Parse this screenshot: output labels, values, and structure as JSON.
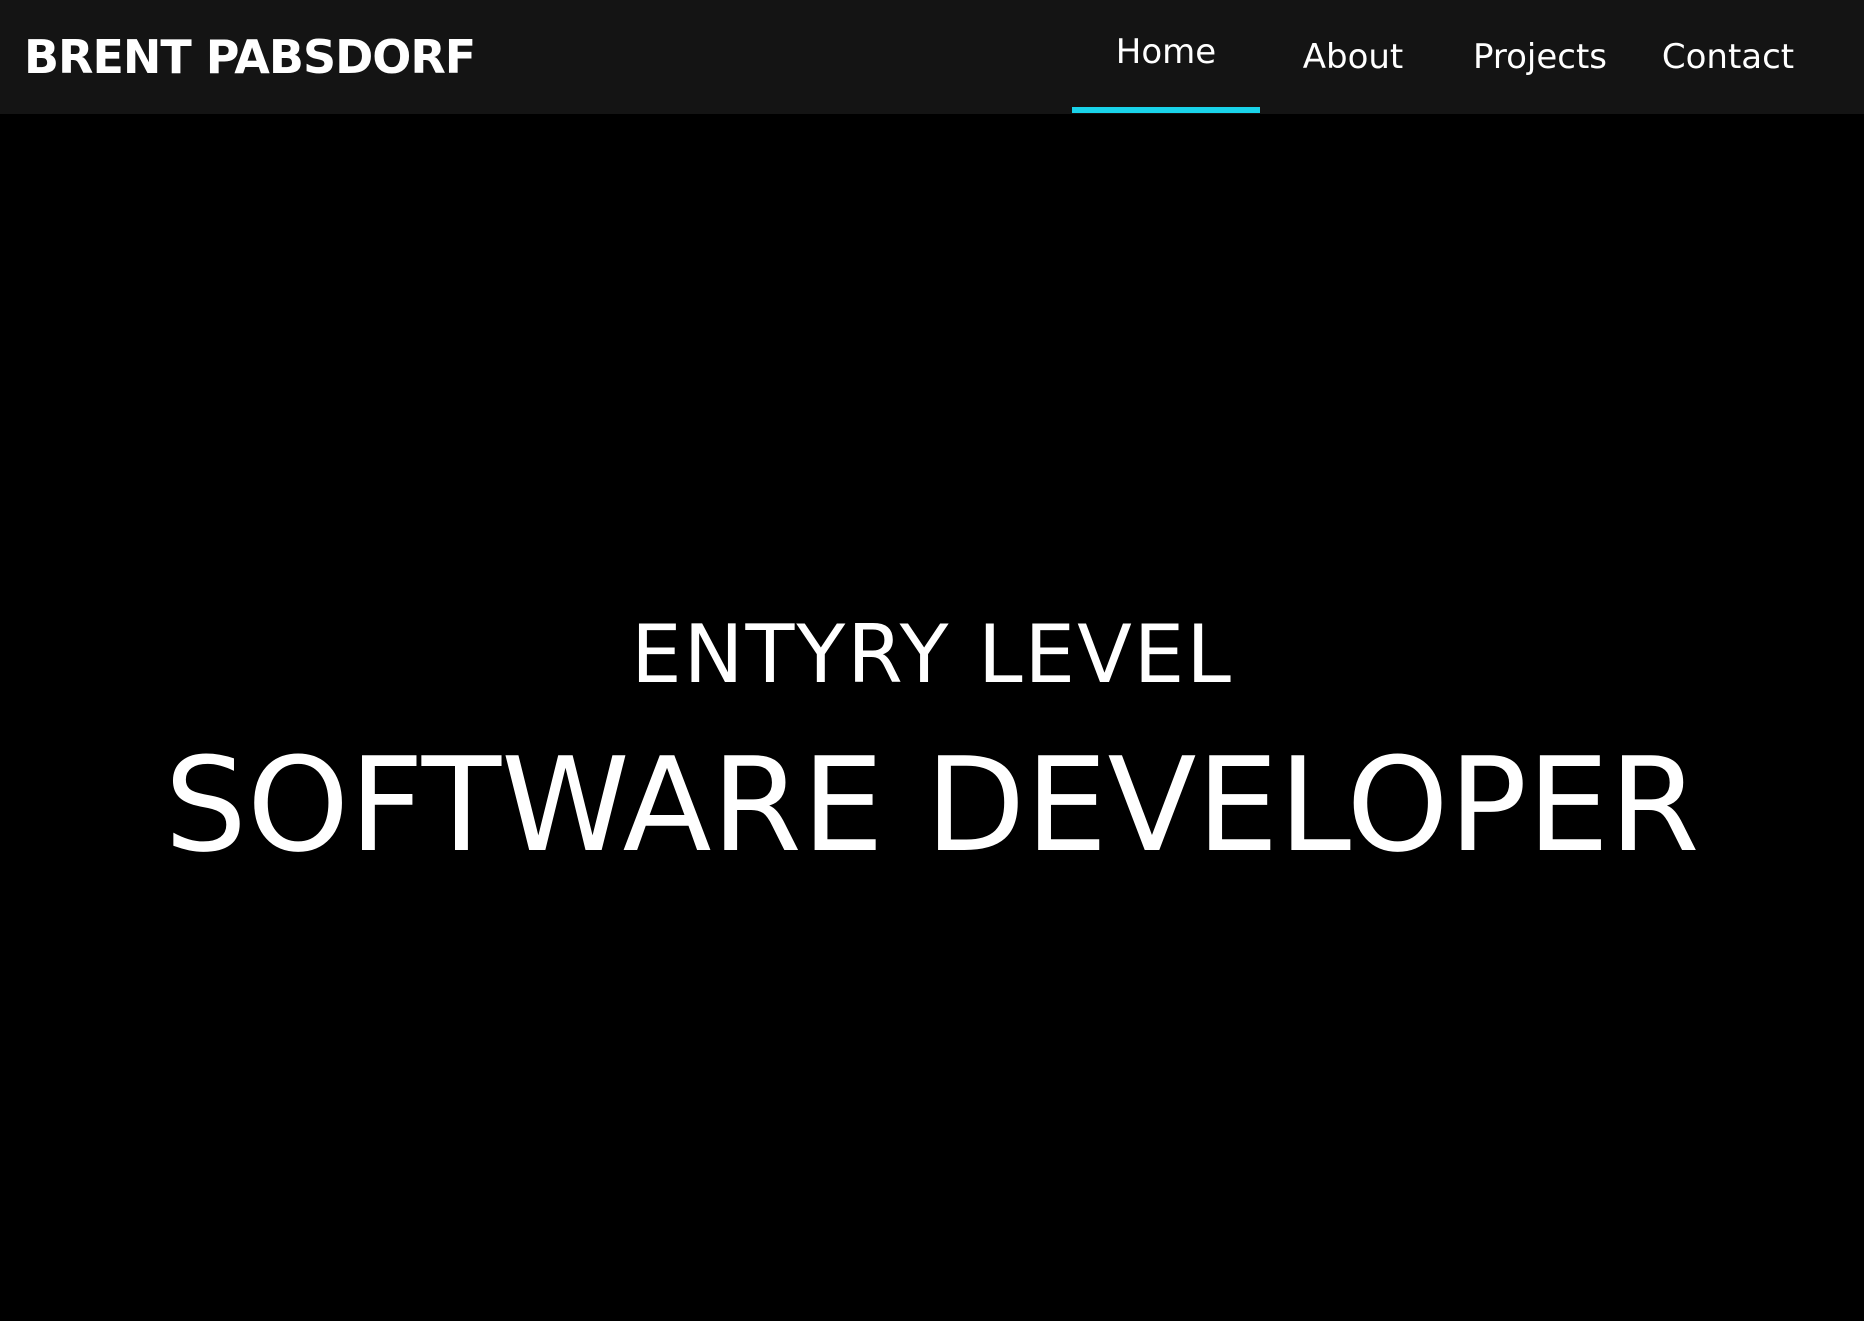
{
  "header": {
    "brand": "BRENT PABSDORF",
    "nav": {
      "home": "Home",
      "about": "About",
      "projects": "Projects",
      "contact": "Contact"
    },
    "active_tab": "Home",
    "accent_color": "#19d3ea",
    "background_color": "#141414"
  },
  "hero": {
    "subtitle": "ENTYRY LEVEL",
    "title": "SOFTWARE DEVELOPER",
    "background_color": "#000000"
  }
}
